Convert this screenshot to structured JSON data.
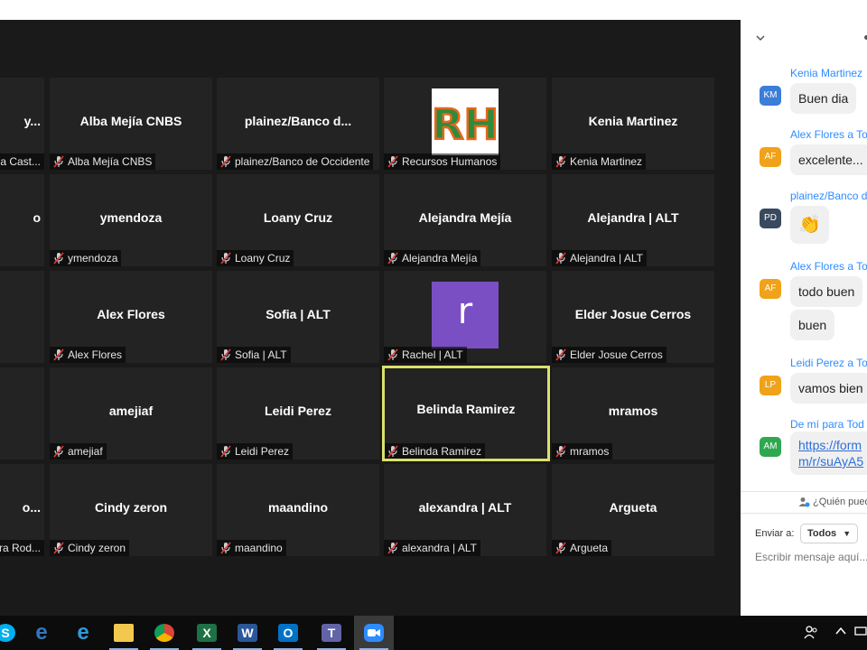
{
  "gallery": {
    "tiles": [
      {
        "display": "y...",
        "label": "a Cast...",
        "row": 0,
        "col": 0
      },
      {
        "display": "Alba Mejía CNBS",
        "label": "Alba Mejía CNBS",
        "row": 0,
        "col": 1
      },
      {
        "display": "plainez/Banco  d...",
        "label": "plainez/Banco de Occidente",
        "row": 0,
        "col": 2
      },
      {
        "display": "",
        "label": "Recursos Humanos",
        "row": 0,
        "col": 3,
        "avatar": "rh-logo"
      },
      {
        "display": "Kenia Martinez",
        "label": "Kenia Martinez",
        "row": 0,
        "col": 4
      },
      {
        "display": "o",
        "label": "",
        "row": 1,
        "col": 0
      },
      {
        "display": "ymendoza",
        "label": "ymendoza",
        "row": 1,
        "col": 1
      },
      {
        "display": "Loany Cruz",
        "label": "Loany Cruz",
        "row": 1,
        "col": 2
      },
      {
        "display": "Alejandra Mejía",
        "label": "Alejandra Mejía",
        "row": 1,
        "col": 3
      },
      {
        "display": "Alejandra | ALT",
        "label": "Alejandra | ALT",
        "row": 1,
        "col": 4
      },
      {
        "display": "",
        "label": "",
        "row": 2,
        "col": 0
      },
      {
        "display": "Alex Flores",
        "label": "Alex Flores",
        "row": 2,
        "col": 1
      },
      {
        "display": "Sofia | ALT",
        "label": "Sofia | ALT",
        "row": 2,
        "col": 2
      },
      {
        "display": "",
        "label": "Rachel | ALT",
        "row": 2,
        "col": 3,
        "avatar": "letter-r",
        "letter": "r"
      },
      {
        "display": "Elder Josue Cerros",
        "label": "Elder Josue Cerros",
        "row": 2,
        "col": 4
      },
      {
        "display": "",
        "label": "",
        "row": 3,
        "col": 0
      },
      {
        "display": "amejiaf",
        "label": "amejiaf",
        "row": 3,
        "col": 1
      },
      {
        "display": "Leidi Perez",
        "label": "Leidi Perez",
        "row": 3,
        "col": 2
      },
      {
        "display": "Belinda Ramirez",
        "label": "Belinda Ramirez",
        "row": 3,
        "col": 3,
        "active": true
      },
      {
        "display": "mramos",
        "label": "mramos",
        "row": 3,
        "col": 4
      },
      {
        "display": "o...",
        "label": "ra Rod...",
        "row": 4,
        "col": 0
      },
      {
        "display": "Cindy zeron",
        "label": "Cindy zeron",
        "row": 4,
        "col": 1
      },
      {
        "display": "maandino",
        "label": "maandino",
        "row": 4,
        "col": 2
      },
      {
        "display": "alexandra | ALT",
        "label": "alexandra | ALT",
        "row": 4,
        "col": 3
      },
      {
        "display": "Argueta",
        "label": "Argueta",
        "row": 4,
        "col": 4
      }
    ],
    "rh_logo_text": "RH"
  },
  "chat": {
    "messages": [
      {
        "sender": "Kenia Martinez",
        "to": "",
        "initials": "KM",
        "color": "#3b7dd8",
        "bubbles": [
          "Buen dia"
        ]
      },
      {
        "sender": "Alex Flores",
        "to": "a To",
        "initials": "AF",
        "color": "#f0a21a",
        "bubbles": [
          "excelente... m"
        ]
      },
      {
        "sender": "plainez/Banco d",
        "to": "",
        "initials": "PD",
        "color": "#394a5e",
        "bubbles": [
          "👏"
        ]
      },
      {
        "sender": "Alex Flores",
        "to": "a To",
        "initials": "AF",
        "color": "#f0a21a",
        "bubbles": [
          "todo buen",
          "buen"
        ]
      },
      {
        "sender": "Leidi Perez",
        "to": "a To",
        "initials": "LP",
        "color": "#f0a21a",
        "bubbles": [
          "vamos bien"
        ]
      },
      {
        "sender": "De mí para",
        "to": "Tod",
        "initials": "AM",
        "color": "#2fa84f",
        "link": "https://form m/r/suAyA5"
      }
    ],
    "who_can_see": "¿Quién pued",
    "send_to_label": "Enviar a:",
    "send_to_value": "Todos",
    "compose_placeholder": "Escribir mensaje aquí..."
  },
  "taskbar": {
    "apps": [
      {
        "name": "skype",
        "glyph": "S",
        "color": "#00aff0"
      },
      {
        "name": "edge",
        "glyph": "e",
        "color": "#3277bc"
      },
      {
        "name": "internet-explorer",
        "glyph": "e",
        "color": "#2f9ad8"
      },
      {
        "name": "file-explorer",
        "glyph": "",
        "color": "#f2c94c"
      },
      {
        "name": "chrome",
        "glyph": "",
        "color": "#db4437"
      },
      {
        "name": "excel",
        "glyph": "X",
        "color": "#1e7145"
      },
      {
        "name": "word",
        "glyph": "W",
        "color": "#2b579a"
      },
      {
        "name": "outlook",
        "glyph": "O",
        "color": "#0072c6"
      },
      {
        "name": "teams",
        "glyph": "T",
        "color": "#6264a7"
      },
      {
        "name": "zoom",
        "glyph": "",
        "color": "#2d8cff"
      }
    ]
  }
}
